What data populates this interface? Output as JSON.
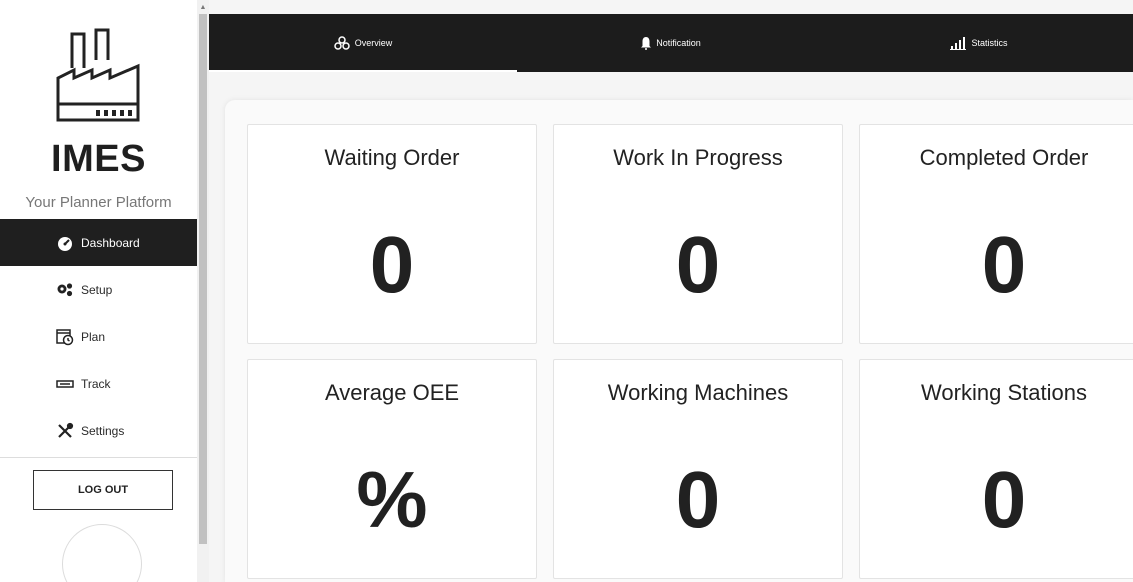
{
  "brand": {
    "name": "IMES",
    "tagline": "Your Planner Platform"
  },
  "nav": [
    {
      "label": "Dashboard",
      "icon": "dashboard-icon",
      "active": true
    },
    {
      "label": "Setup",
      "icon": "gears-icon",
      "active": false
    },
    {
      "label": "Plan",
      "icon": "calendar-clock-icon",
      "active": false
    },
    {
      "label": "Track",
      "icon": "track-icon",
      "active": false
    },
    {
      "label": "Settings",
      "icon": "tools-icon",
      "active": false
    }
  ],
  "logout_label": "LOG OUT",
  "tabs": [
    {
      "label": "Overview",
      "icon": "overview-icon",
      "active": true
    },
    {
      "label": "Notification",
      "icon": "bell-icon",
      "active": false
    },
    {
      "label": "Statistics",
      "icon": "bar-chart-icon",
      "active": false
    }
  ],
  "cards": [
    {
      "title": "Waiting Order",
      "value": "0"
    },
    {
      "title": "Work In Progress",
      "value": "0"
    },
    {
      "title": "Completed Order",
      "value": "0"
    },
    {
      "title": "Average OEE",
      "value": "%"
    },
    {
      "title": "Working Machines",
      "value": "0"
    },
    {
      "title": "Working Stations",
      "value": "0"
    }
  ],
  "colors": {
    "dark": "#1c1c1c",
    "background": "#f5f5f5",
    "text": "#212121"
  }
}
